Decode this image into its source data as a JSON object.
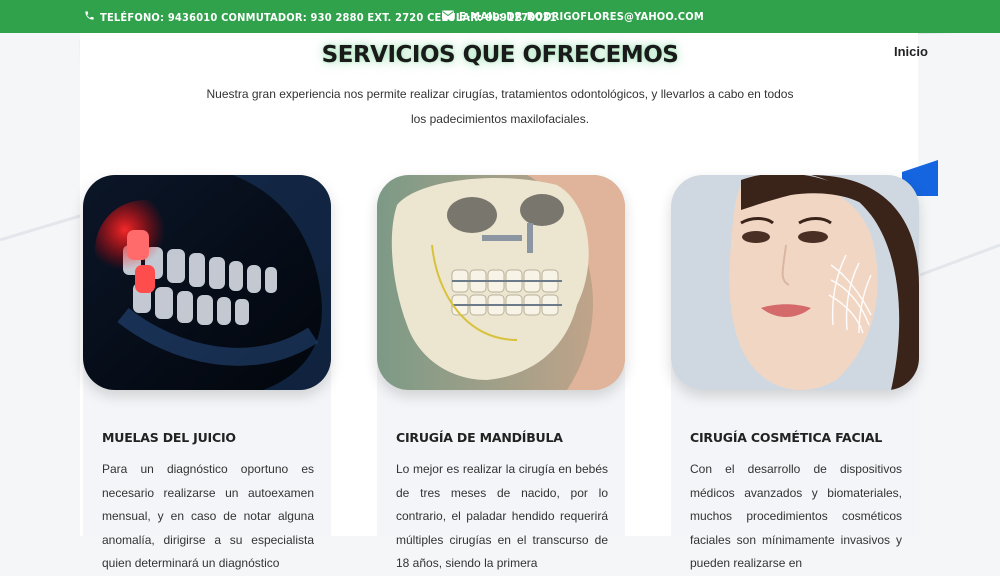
{
  "topbar": {
    "phone_text": "TELÉFONO: 9436010 CONMUTADOR: 930 2880 EXT. 2720 CELULAR: 9991270031",
    "email_text": "E-MAIL: DR.RODRIGOFLORES@YAHOO.COM",
    "phone_icon": "phone-icon",
    "email_icon": "envelope-icon"
  },
  "nav": {
    "home": "Inicio"
  },
  "section": {
    "title": "SERVICIOS QUE OFRECEMOS",
    "intro": "Nuestra gran experiencia nos permite realizar cirugías, tratamientos odontológicos, y llevarlos a cabo en todos los padecimientos maxilofaciales."
  },
  "cards": [
    {
      "title": "MUELAS DEL JUICIO",
      "text": "Para un diagnóstico oportuno es necesario realizarse un autoexamen mensual, y en caso de notar alguna anomalía, dirigirse a su especialista quien determinará un diagnóstico",
      "image": "wisdom-teeth-xray-image"
    },
    {
      "title": "CIRUGÍA DE MANDÍBULA",
      "text": "Lo mejor es realizar la cirugía en bebés de tres meses de nacido, por lo contrario, el paladar hendido requerirá múltiples cirugías en el transcurso de 18 años, siendo la primera",
      "image": "jaw-surgery-skull-image"
    },
    {
      "title": "CIRUGÍA COSMÉTICA FACIAL",
      "text": "Con el desarrollo de dispositivos médicos avanzados y biomateriales, muchos procedimientos cosméticos faciales son mínimamente invasivos y pueden realizarse en",
      "image": "facial-cosmetic-woman-image"
    }
  ],
  "colors": {
    "topbar": "#31a24c",
    "accent_blue": "#1565e0"
  }
}
